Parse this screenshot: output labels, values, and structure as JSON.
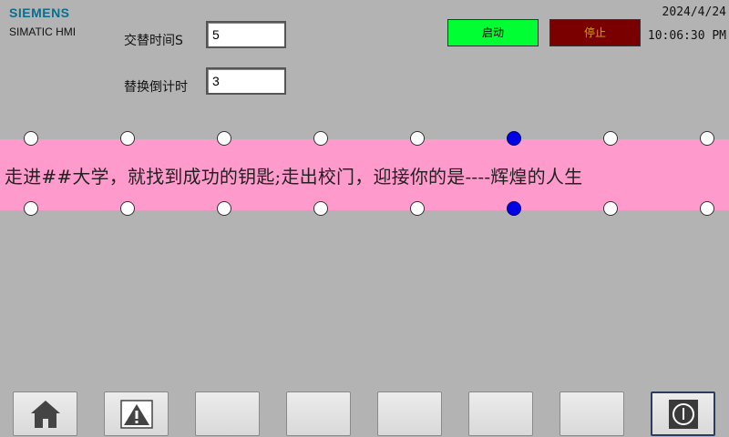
{
  "brand": {
    "logo_text": "SIEMENS",
    "product": "SIMATIC HMI"
  },
  "fields": {
    "alternate_time_label": "交替时间S",
    "alternate_time_value": "5",
    "swap_countdown_label": "替换倒计时",
    "swap_countdown_value": "3"
  },
  "buttons": {
    "start_label": "启动",
    "start_color": "#00ff33",
    "stop_label": "停止",
    "stop_color": "#7a0000"
  },
  "clock": {
    "date": "2024/4/24",
    "time": "10:06:30 PM"
  },
  "banner": {
    "text": "走进##大学，就找到成功的钥匙;走出校门，迎接你的是----辉煌的人生",
    "background": "#ff9bcc",
    "lamps_top": [
      false,
      false,
      false,
      false,
      false,
      true,
      false,
      false
    ],
    "lamps_bottom": [
      false,
      false,
      false,
      false,
      false,
      true,
      false,
      false
    ],
    "lamp_on_color": "#0000e6"
  },
  "function_keys": [
    "home-icon",
    "warning-icon",
    "",
    "",
    "",
    "",
    "",
    "power-icon"
  ]
}
